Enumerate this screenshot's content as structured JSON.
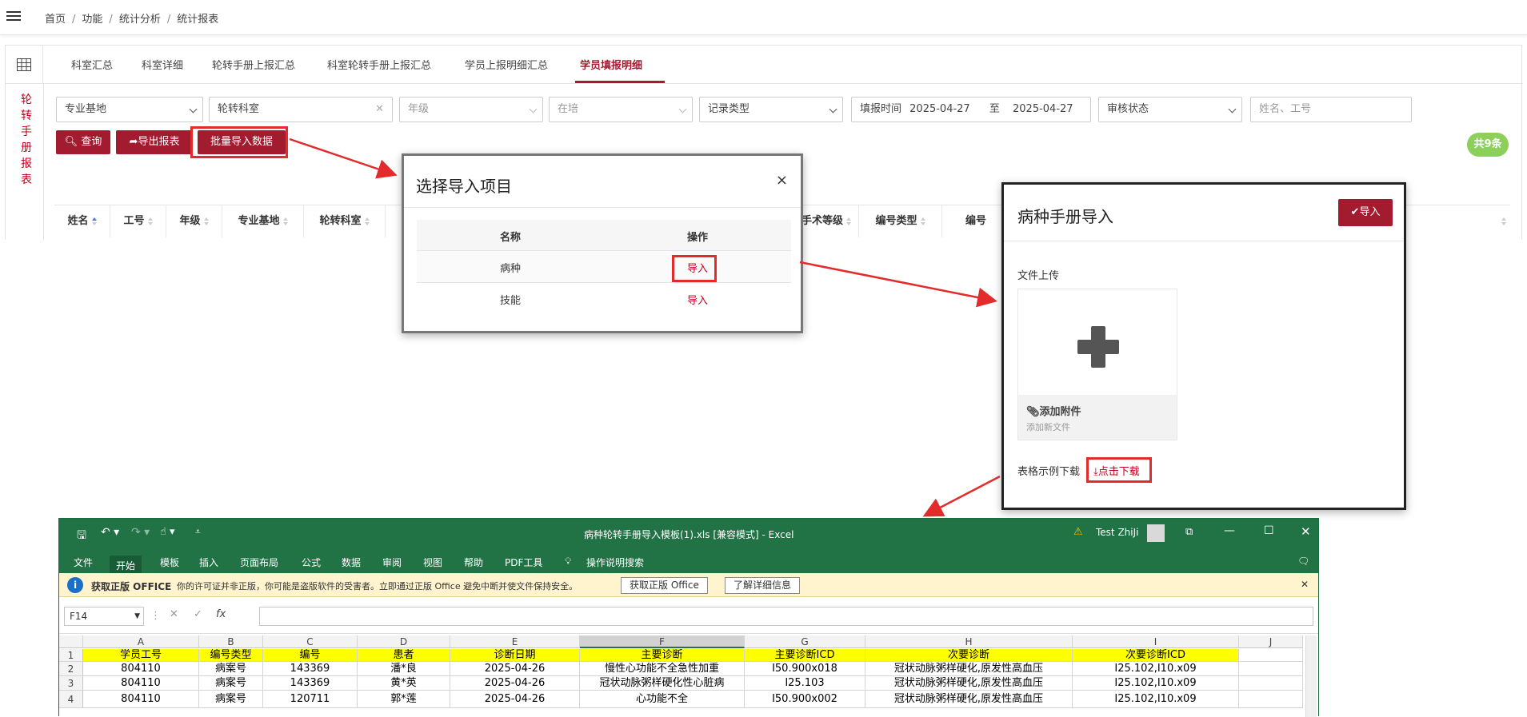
{
  "breadcrumb": [
    "首页",
    "功能",
    "统计分析",
    "统计报表"
  ],
  "tabs": [
    "科室汇总",
    "科室详细",
    "轮转手册上报汇总",
    "科室轮转手册上报汇总",
    "学员上报明细汇总",
    "学员填报明细"
  ],
  "active_tab": "学员填报明细",
  "sidebar_title": [
    "轮",
    "转",
    "手",
    "册",
    "报",
    "表"
  ],
  "filters": {
    "base": "专业基地",
    "dept": "轮转科室",
    "grade": "年级",
    "status": "在培",
    "record_type": "记录类型",
    "date_label": "填报时间",
    "date_from": "2025-04-27",
    "date_to_sep": "至",
    "date_to": "2025-04-27",
    "audit": "审核状态",
    "name_placeholder": "姓名、工号"
  },
  "buttons": {
    "query": "查询",
    "export": "导出报表",
    "batch_import": "批量导入数据"
  },
  "total_badge": "共9条",
  "table_headers": [
    "姓名",
    "工号",
    "年级",
    "专业基地",
    "轮转科室",
    "手术等级",
    "编号类型",
    "编号"
  ],
  "modal_select": {
    "title": "选择导入项目",
    "close": "×",
    "col_name": "名称",
    "col_op": "操作",
    "rows": [
      {
        "name": "病种",
        "op": "导入"
      },
      {
        "name": "技能",
        "op": "导入"
      }
    ]
  },
  "modal_import": {
    "title": "病种手册导入",
    "import_btn": "导入",
    "upload_label": "文件上传",
    "add_attachment": "添加附件",
    "add_new_file": "添加新文件",
    "sample_label": "表格示例下载",
    "download_link": "点击下载"
  },
  "excel": {
    "title": "病种轮转手册导入模板(1).xls  [兼容模式]  -  Excel",
    "user": "Test ZhiJi",
    "menu": [
      "文件",
      "开始",
      "模板",
      "插入",
      "页面布局",
      "公式",
      "数据",
      "审阅",
      "视图",
      "帮助",
      "PDF工具",
      "操作说明搜索"
    ],
    "warn_title": "获取正版 OFFICE",
    "warn_text": "你的许可证并非正版，你可能是盗版软件的受害者。立即通过正版 Office 避免中断并使文件保持安全。",
    "warn_btn1": "获取正版 Office",
    "warn_btn2": "了解详细信息",
    "namebox": "F14",
    "columns": [
      "A",
      "B",
      "C",
      "D",
      "E",
      "F",
      "G",
      "H",
      "I",
      "J"
    ],
    "rows": [
      [
        "学员工号",
        "编号类型",
        "编号",
        "患者",
        "诊断日期",
        "主要诊断",
        "主要诊断ICD",
        "次要诊断",
        "次要诊断ICD"
      ],
      [
        "804110",
        "病案号",
        "143369",
        "潘*良",
        "2025-04-26",
        "慢性心功能不全急性加重",
        "I50.900x018",
        "冠状动脉粥样硬化,原发性高血压",
        "I25.102,I10.x09"
      ],
      [
        "804110",
        "病案号",
        "143369",
        "黄*英",
        "2025-04-26",
        "冠状动脉粥样硬化性心脏病",
        "I25.103",
        "冠状动脉粥样硬化,原发性高血压",
        "I25.102,I10.x09"
      ],
      [
        "804110",
        "病案号",
        "120711",
        "郭*莲",
        "2025-04-26",
        "心功能不全",
        "I50.900x002",
        "冠状动脉粥样硬化,原发性高血压",
        "I25.102,I10.x09"
      ]
    ],
    "row_numbers": [
      "1",
      "2",
      "3",
      "4"
    ]
  }
}
